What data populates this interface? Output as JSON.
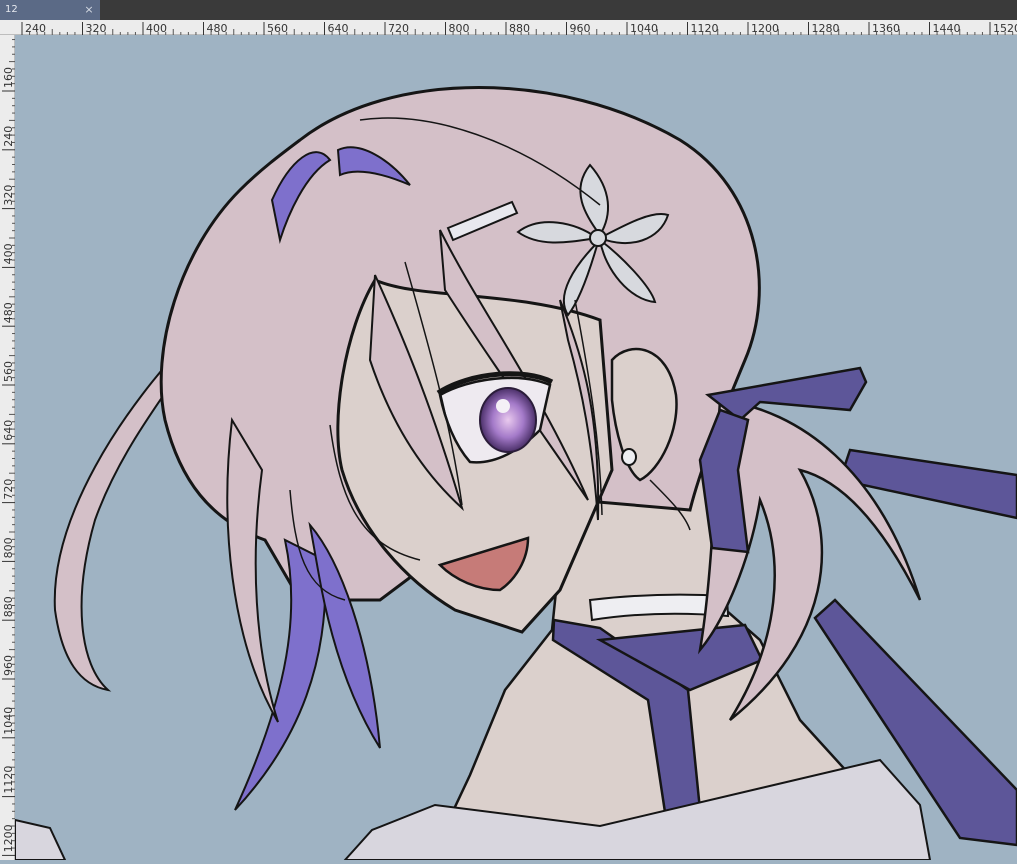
{
  "document_tab": {
    "title": "12",
    "close_glyph": "×"
  },
  "ruler": {
    "horizontal_labels": [
      "240",
      "320",
      "400",
      "480",
      "560",
      "640",
      "720",
      "800",
      "880",
      "960",
      "1040",
      "1120",
      "1200",
      "1280",
      "1360",
      "1440",
      "1520"
    ],
    "vertical_labels": [
      "160",
      "240",
      "320",
      "400",
      "480",
      "560",
      "640",
      "720",
      "800",
      "880",
      "960",
      "1040",
      "1120",
      "1200"
    ]
  },
  "colors": {
    "canvas_bg": "#9fb3c3",
    "hair": "#d4c0c8",
    "hair_shadow": "#7e70cc",
    "skin": "#dbd0cc",
    "ribbon": "#5d5699",
    "flower": "#d7d9de",
    "eye": "#a47ac9",
    "mouth": "#c67b78",
    "line": "#151515"
  }
}
